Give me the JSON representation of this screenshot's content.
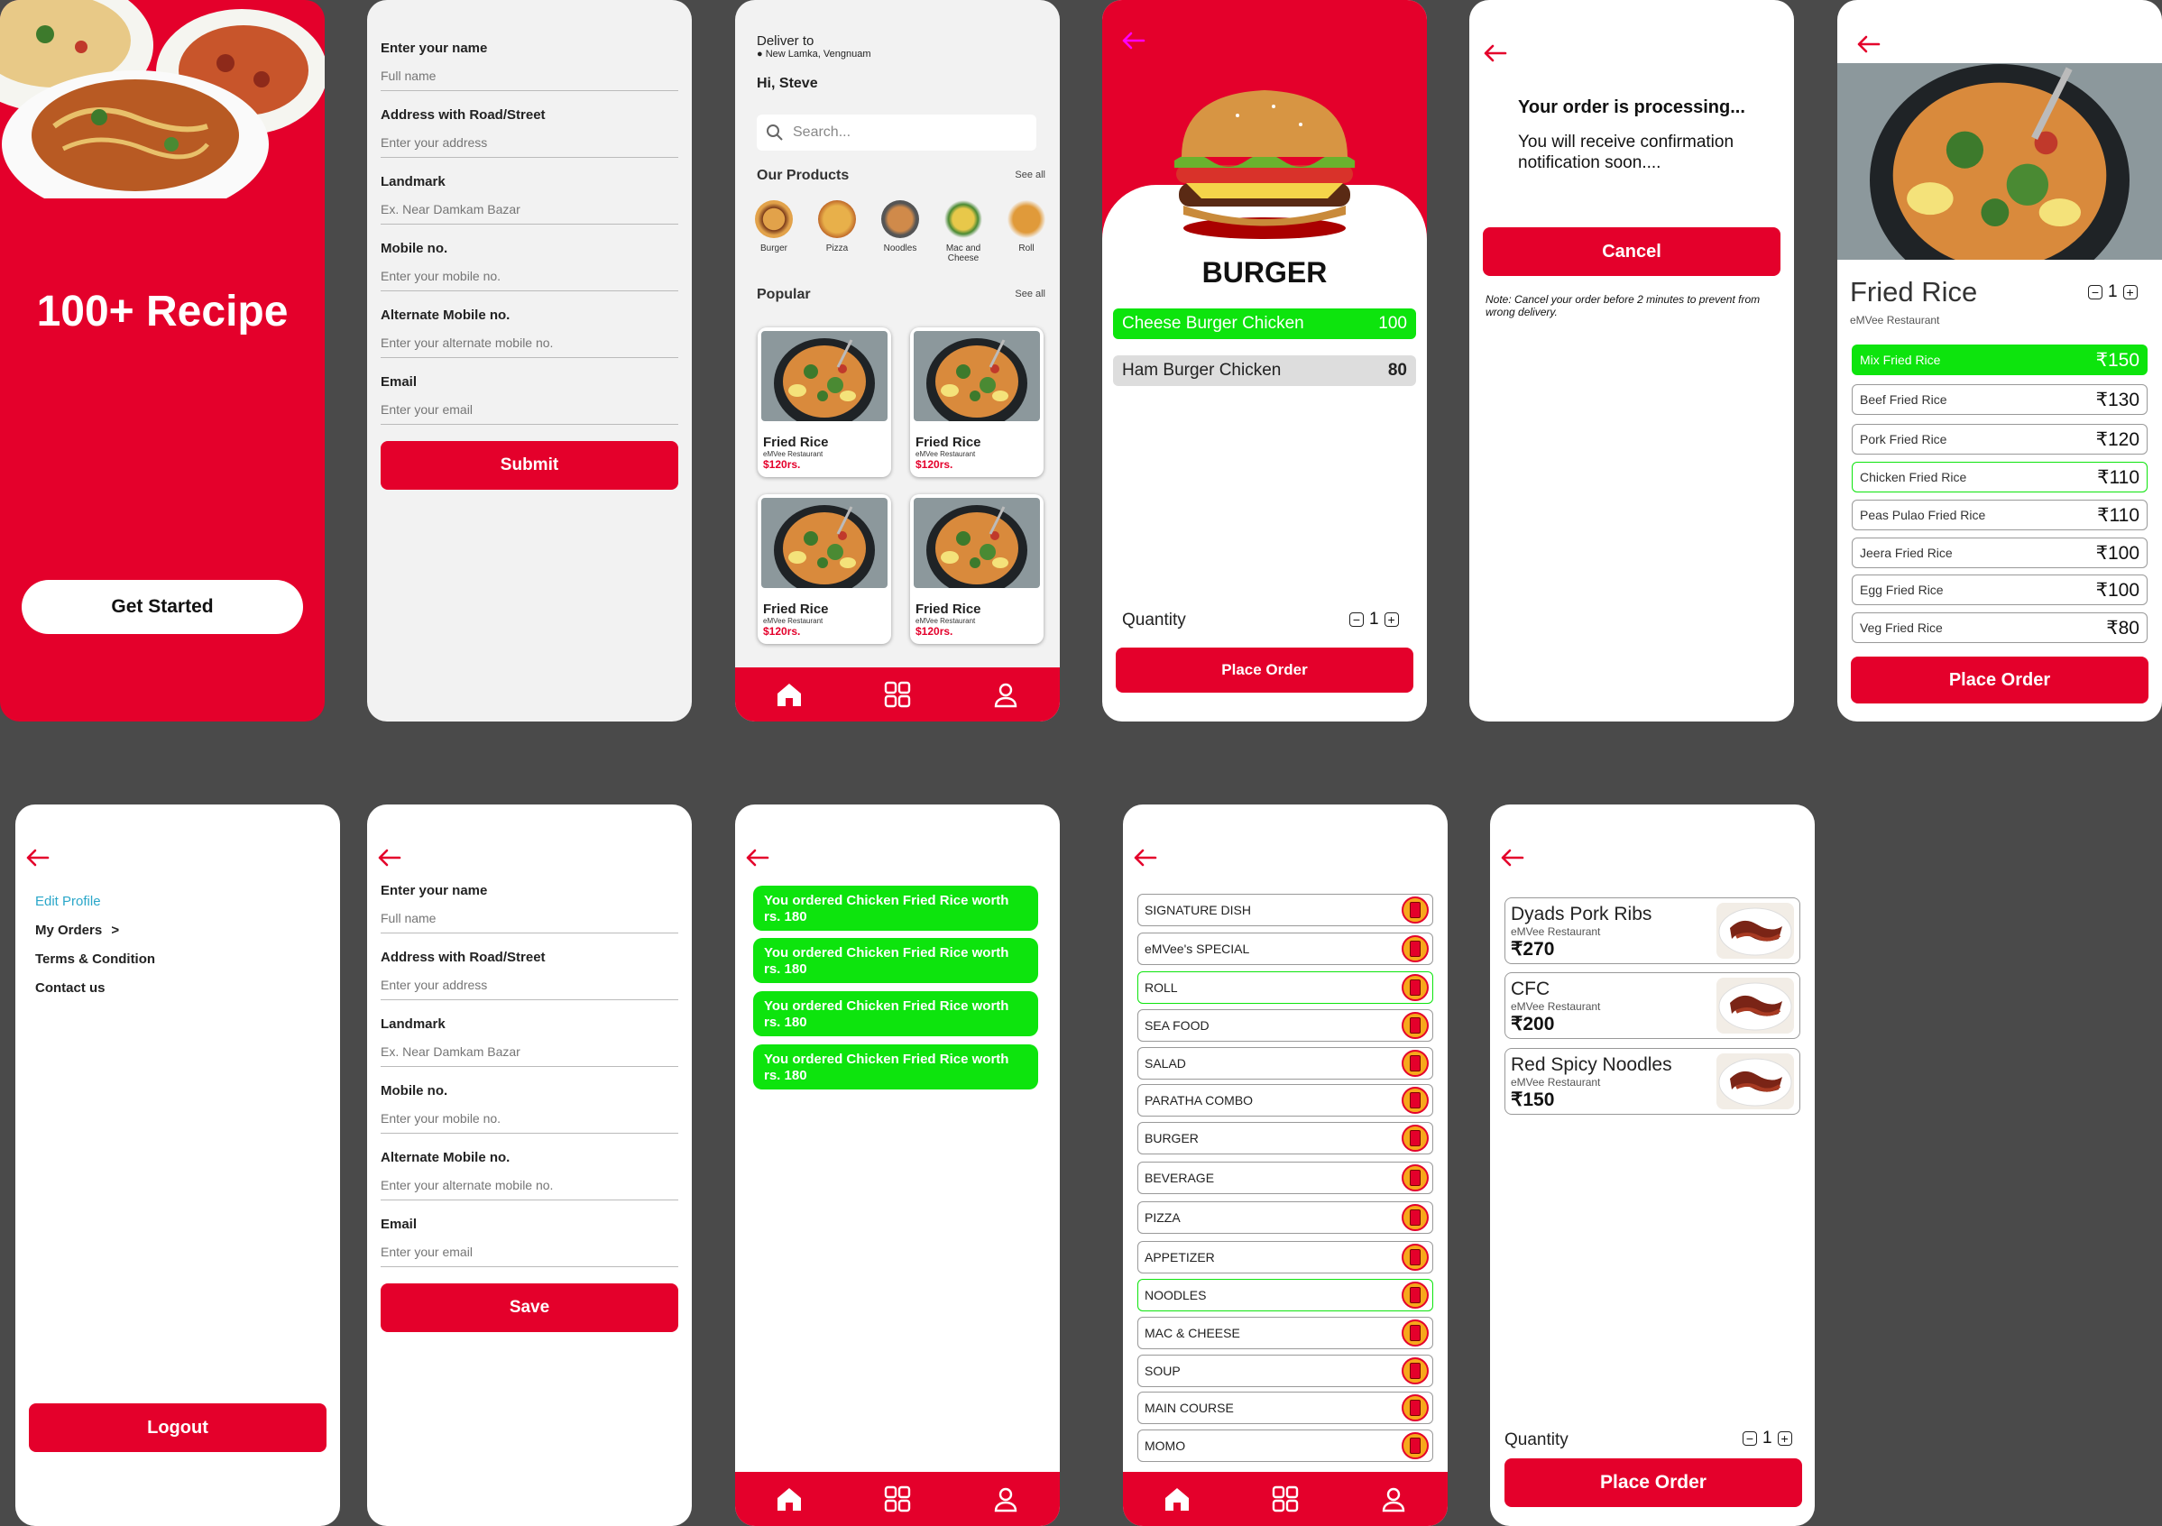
{
  "accent": "#e4002b",
  "success": "#0de40d",
  "splash": {
    "title": "100+ Recipe",
    "cta": "Get Started"
  },
  "address_form": {
    "fields": [
      {
        "label": "Enter your name",
        "placeholder": "Full name"
      },
      {
        "label": "Address with Road/Street",
        "placeholder": "Enter your address"
      },
      {
        "label": "Landmark",
        "placeholder": "Ex. Near Damkam Bazar"
      },
      {
        "label": "Mobile no.",
        "placeholder": "Enter your mobile no."
      },
      {
        "label": "Alternate Mobile no.",
        "placeholder": "Enter your alternate mobile no."
      },
      {
        "label": "Email",
        "placeholder": "Enter your email"
      }
    ],
    "submit": "Submit"
  },
  "home": {
    "deliver_to": "Deliver to",
    "location": "New Lamka, Vengnuam",
    "greeting": "Hi, Steve",
    "search_placeholder": "Search...",
    "products_heading": "Our Products",
    "popular_heading": "Popular",
    "see_all": "See all",
    "products": [
      "Burger",
      "Pizza",
      "Noodles",
      "Mac and Cheese",
      "Roll"
    ],
    "popular": [
      {
        "title": "Fried Rice",
        "restaurant": "eMVee Restaurant",
        "price": "$120rs."
      },
      {
        "title": "Fried Rice",
        "restaurant": "eMVee Restaurant",
        "price": "$120rs."
      },
      {
        "title": "Fried Rice",
        "restaurant": "eMVee Restaurant",
        "price": "$120rs."
      },
      {
        "title": "Fried Rice",
        "restaurant": "eMVee Restaurant",
        "price": "$120rs."
      }
    ]
  },
  "burger": {
    "title": "BURGER",
    "options": [
      {
        "name": "Cheese Burger Chicken",
        "price": "100",
        "selected": true
      },
      {
        "name": "Ham Burger Chicken",
        "price": "80",
        "selected": false
      }
    ],
    "quantity_label": "Quantity",
    "quantity": "1",
    "place_order": "Place Order"
  },
  "processing": {
    "heading": "Your order is processing...",
    "message": "You will receive confirmation notification soon....",
    "cancel": "Cancel",
    "note": "Note:  Cancel your order before 2 minutes to prevent from wrong delivery."
  },
  "fried_rice": {
    "title": "Fried Rice",
    "restaurant": "eMVee Restaurant",
    "quantity": "1",
    "items": [
      {
        "name": "Mix Fried Rice",
        "price": "₹150"
      },
      {
        "name": "Beef Fried Rice",
        "price": "₹130"
      },
      {
        "name": "Pork Fried Rice",
        "price": "₹120"
      },
      {
        "name": "Chicken Fried Rice",
        "price": "₹110"
      },
      {
        "name": "Peas Pulao Fried Rice",
        "price": "₹110"
      },
      {
        "name": "Jeera Fried Rice",
        "price": "₹100"
      },
      {
        "name": "Egg Fried Rice",
        "price": "₹100"
      },
      {
        "name": "Veg Fried Rice",
        "price": "₹80"
      }
    ],
    "place_order": "Place Order"
  },
  "profile": {
    "edit_profile": "Edit Profile",
    "my_orders": "My Orders",
    "my_orders_chevron": ">",
    "terms": "Terms & Condition",
    "contact": "Contact us",
    "logout": "Logout"
  },
  "edit_form": {
    "save": "Save"
  },
  "orders": {
    "items": [
      "You ordered  Chicken Fried Rice  worth rs. 180",
      "You ordered  Chicken Fried Rice  worth rs. 180",
      "You ordered  Chicken Fried Rice  worth rs. 180",
      "You ordered  Chicken Fried Rice  worth rs. 180"
    ]
  },
  "menu": {
    "categories": [
      "SIGNATURE DISH",
      "eMVee's SPECIAL",
      "ROLL",
      "SEA FOOD",
      "SALAD",
      "PARATHA COMBO",
      "BURGER",
      "BEVERAGE",
      "PIZZA",
      "APPETIZER",
      "NOODLES",
      "MAC & CHEESE",
      "SOUP",
      "MAIN COURSE",
      "MOMO"
    ]
  },
  "dishes": {
    "items": [
      {
        "name": "Dyads Pork Ribs",
        "restaurant": "eMVee Restaurant",
        "price": "₹270"
      },
      {
        "name": "CFC",
        "restaurant": "eMVee Restaurant",
        "price": "₹200"
      },
      {
        "name": "Red Spicy Noodles",
        "restaurant": "eMVee Restaurant",
        "price": "₹150"
      }
    ],
    "quantity_label": "Quantity",
    "quantity": "1",
    "place_order": "Place Order"
  }
}
